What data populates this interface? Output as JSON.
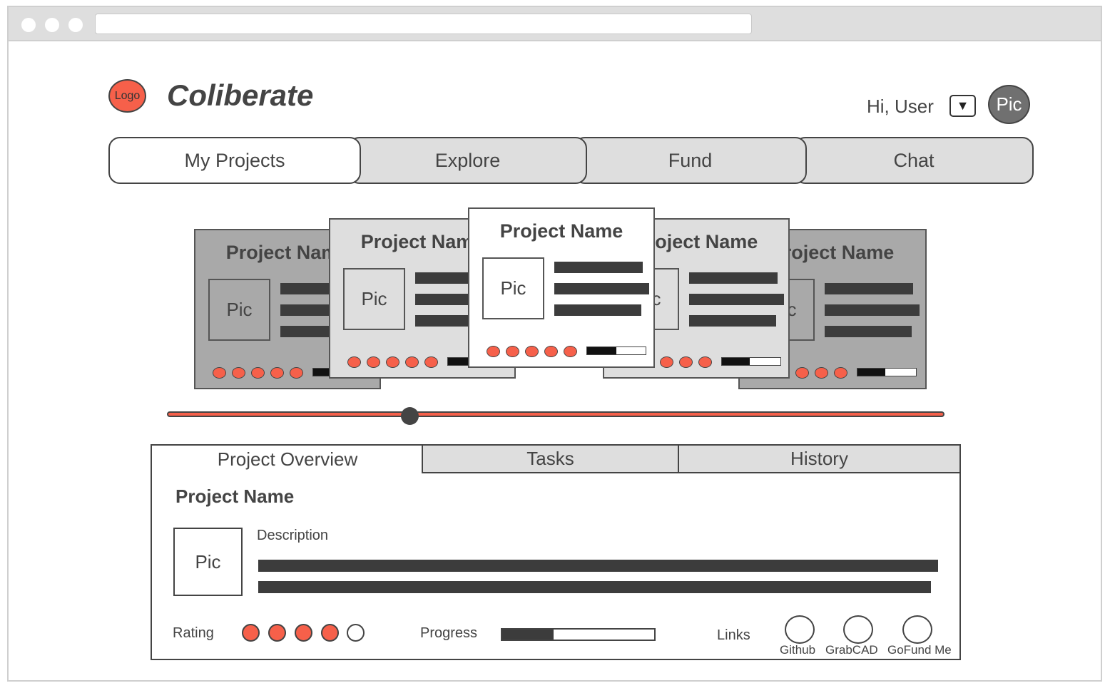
{
  "header": {
    "logo_label": "Logo",
    "brand": "Coliberate",
    "greeting": "Hi, User",
    "dropdown_glyph": "▼",
    "avatar_label": "Pic"
  },
  "nav": {
    "tabs": [
      {
        "label": "My Projects",
        "active": true
      },
      {
        "label": "Explore",
        "active": false
      },
      {
        "label": "Fund",
        "active": false
      },
      {
        "label": "Chat",
        "active": false
      }
    ]
  },
  "carousel": {
    "cards": [
      {
        "title": "Project Name",
        "pic": "Pic",
        "rating": 5,
        "progress": 0.55
      },
      {
        "title": "Project Name",
        "pic": "Pic",
        "rating": 5,
        "progress": 0.5
      },
      {
        "title": "Project Name",
        "pic": "Pic",
        "rating": 5,
        "progress": 0.5
      },
      {
        "title": "Project Name",
        "pic": "Pic",
        "rating": 5,
        "progress": 0.48
      },
      {
        "title": "Project Name",
        "pic": "Pic",
        "rating": 5,
        "progress": 0.48
      }
    ],
    "slider_position": 0.31
  },
  "details": {
    "tabs": [
      {
        "label": "Project Overview",
        "active": true
      },
      {
        "label": "Tasks",
        "active": false
      },
      {
        "label": "History",
        "active": false
      }
    ],
    "project_name": "Project Name",
    "pic_label": "Pic",
    "description_label": "Description",
    "rating_label": "Rating",
    "rating": 4,
    "rating_max": 5,
    "progress_label": "Progress",
    "progress": 0.34,
    "links_label": "Links",
    "links": [
      {
        "label": "Github"
      },
      {
        "label": "GrabCAD"
      },
      {
        "label": "GoFund Me"
      }
    ]
  },
  "colors": {
    "accent": "#f6604a",
    "tab_inactive": "#dedede",
    "ink": "#444444"
  }
}
